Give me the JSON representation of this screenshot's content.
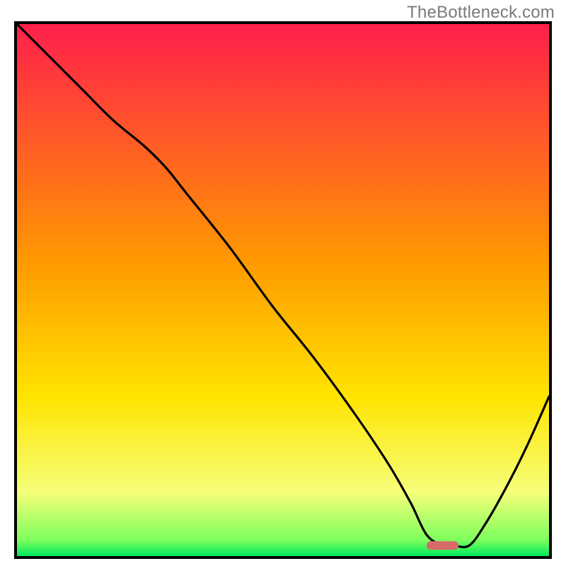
{
  "watermark": "TheBottleneck.com",
  "colors": {
    "gradient_top": "#ff1f4b",
    "gradient_mid": "#ffd400",
    "gradient_low": "#f6ff7a",
    "gradient_bottom": "#00e85c",
    "curve": "#000000",
    "marker": "#d96a6a",
    "frame": "#000000"
  },
  "chart_data": {
    "type": "line",
    "title": "",
    "xlabel": "",
    "ylabel": "",
    "xlim": [
      0,
      100
    ],
    "ylim": [
      0,
      100
    ],
    "series": [
      {
        "name": "curve",
        "x": [
          0,
          6,
          12,
          18,
          24,
          28,
          32,
          40,
          48,
          56,
          64,
          70,
          74,
          77,
          80,
          82,
          85,
          88,
          92,
          96,
          100
        ],
        "y": [
          100,
          94,
          88,
          82,
          77,
          73,
          68,
          58,
          47,
          37,
          26,
          17,
          10,
          4,
          2,
          2,
          2,
          6,
          13,
          21,
          30
        ]
      }
    ],
    "marker": {
      "x_start": 77,
      "x_end": 83,
      "y": 2,
      "color": "#d96a6a"
    },
    "background_gradient_stops": [
      {
        "pos": 0.0,
        "color": "#ff1f4b"
      },
      {
        "pos": 0.45,
        "color": "#ff9a00"
      },
      {
        "pos": 0.7,
        "color": "#ffe400"
      },
      {
        "pos": 0.88,
        "color": "#f6ff7a"
      },
      {
        "pos": 0.97,
        "color": "#7dff5c"
      },
      {
        "pos": 1.0,
        "color": "#00e85c"
      }
    ]
  }
}
